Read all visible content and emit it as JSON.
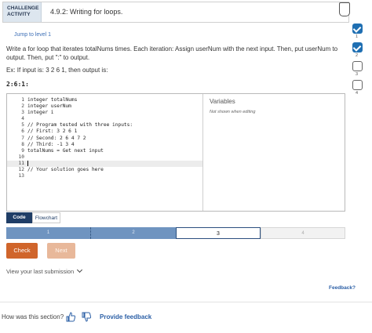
{
  "header": {
    "badge_line1": "CHALLENGE",
    "badge_line2": "ACTIVITY",
    "title": "4.9.2: Writing for loops."
  },
  "levels": [
    {
      "num": "1",
      "status": "done"
    },
    {
      "num": "2",
      "status": "done"
    },
    {
      "num": "3",
      "status": "open"
    },
    {
      "num": "4",
      "status": "open"
    }
  ],
  "jump_link": "Jump to level 1",
  "description": "Write a for loop that iterates totalNums times. Each iteration: Assign userNum with the next input. Then, put userNum to output. Then, put \":\" to output.",
  "example": "Ex: If input is: 3 2 6 1, then output is:",
  "expected_output": "2:6:1:",
  "code_lines": [
    {
      "n": "1",
      "text": "integer totalNums"
    },
    {
      "n": "2",
      "text": "integer userNum"
    },
    {
      "n": "3",
      "text": "integer i"
    },
    {
      "n": "4",
      "text": ""
    },
    {
      "n": "5",
      "text": "// Program tested with three inputs:"
    },
    {
      "n": "6",
      "text": "// First: 3 2 6 1"
    },
    {
      "n": "7",
      "text": "// Second: 2 6 4 7 2"
    },
    {
      "n": "8",
      "text": "// Third: -1 3 4"
    },
    {
      "n": "9",
      "text": "totalNums = Get next input"
    },
    {
      "n": "10",
      "text": ""
    },
    {
      "n": "11",
      "text": ""
    },
    {
      "n": "12",
      "text": "// Your solution goes here"
    },
    {
      "n": "13",
      "text": ""
    }
  ],
  "variables": {
    "title": "Variables",
    "note": "Not shown when editing"
  },
  "tabs": {
    "code": "Code",
    "flowchart": "Flowchart"
  },
  "progress": [
    "1",
    "2",
    "3",
    "4"
  ],
  "buttons": {
    "check": "Check",
    "next": "Next"
  },
  "view_last": "View your last submission",
  "feedback": "Feedback?",
  "rating": {
    "question": "How was this section?",
    "provide": "Provide feedback"
  },
  "colors": {
    "primary": "#1f6fb2",
    "check_button": "#d0652b",
    "link": "#2b5fa6"
  }
}
